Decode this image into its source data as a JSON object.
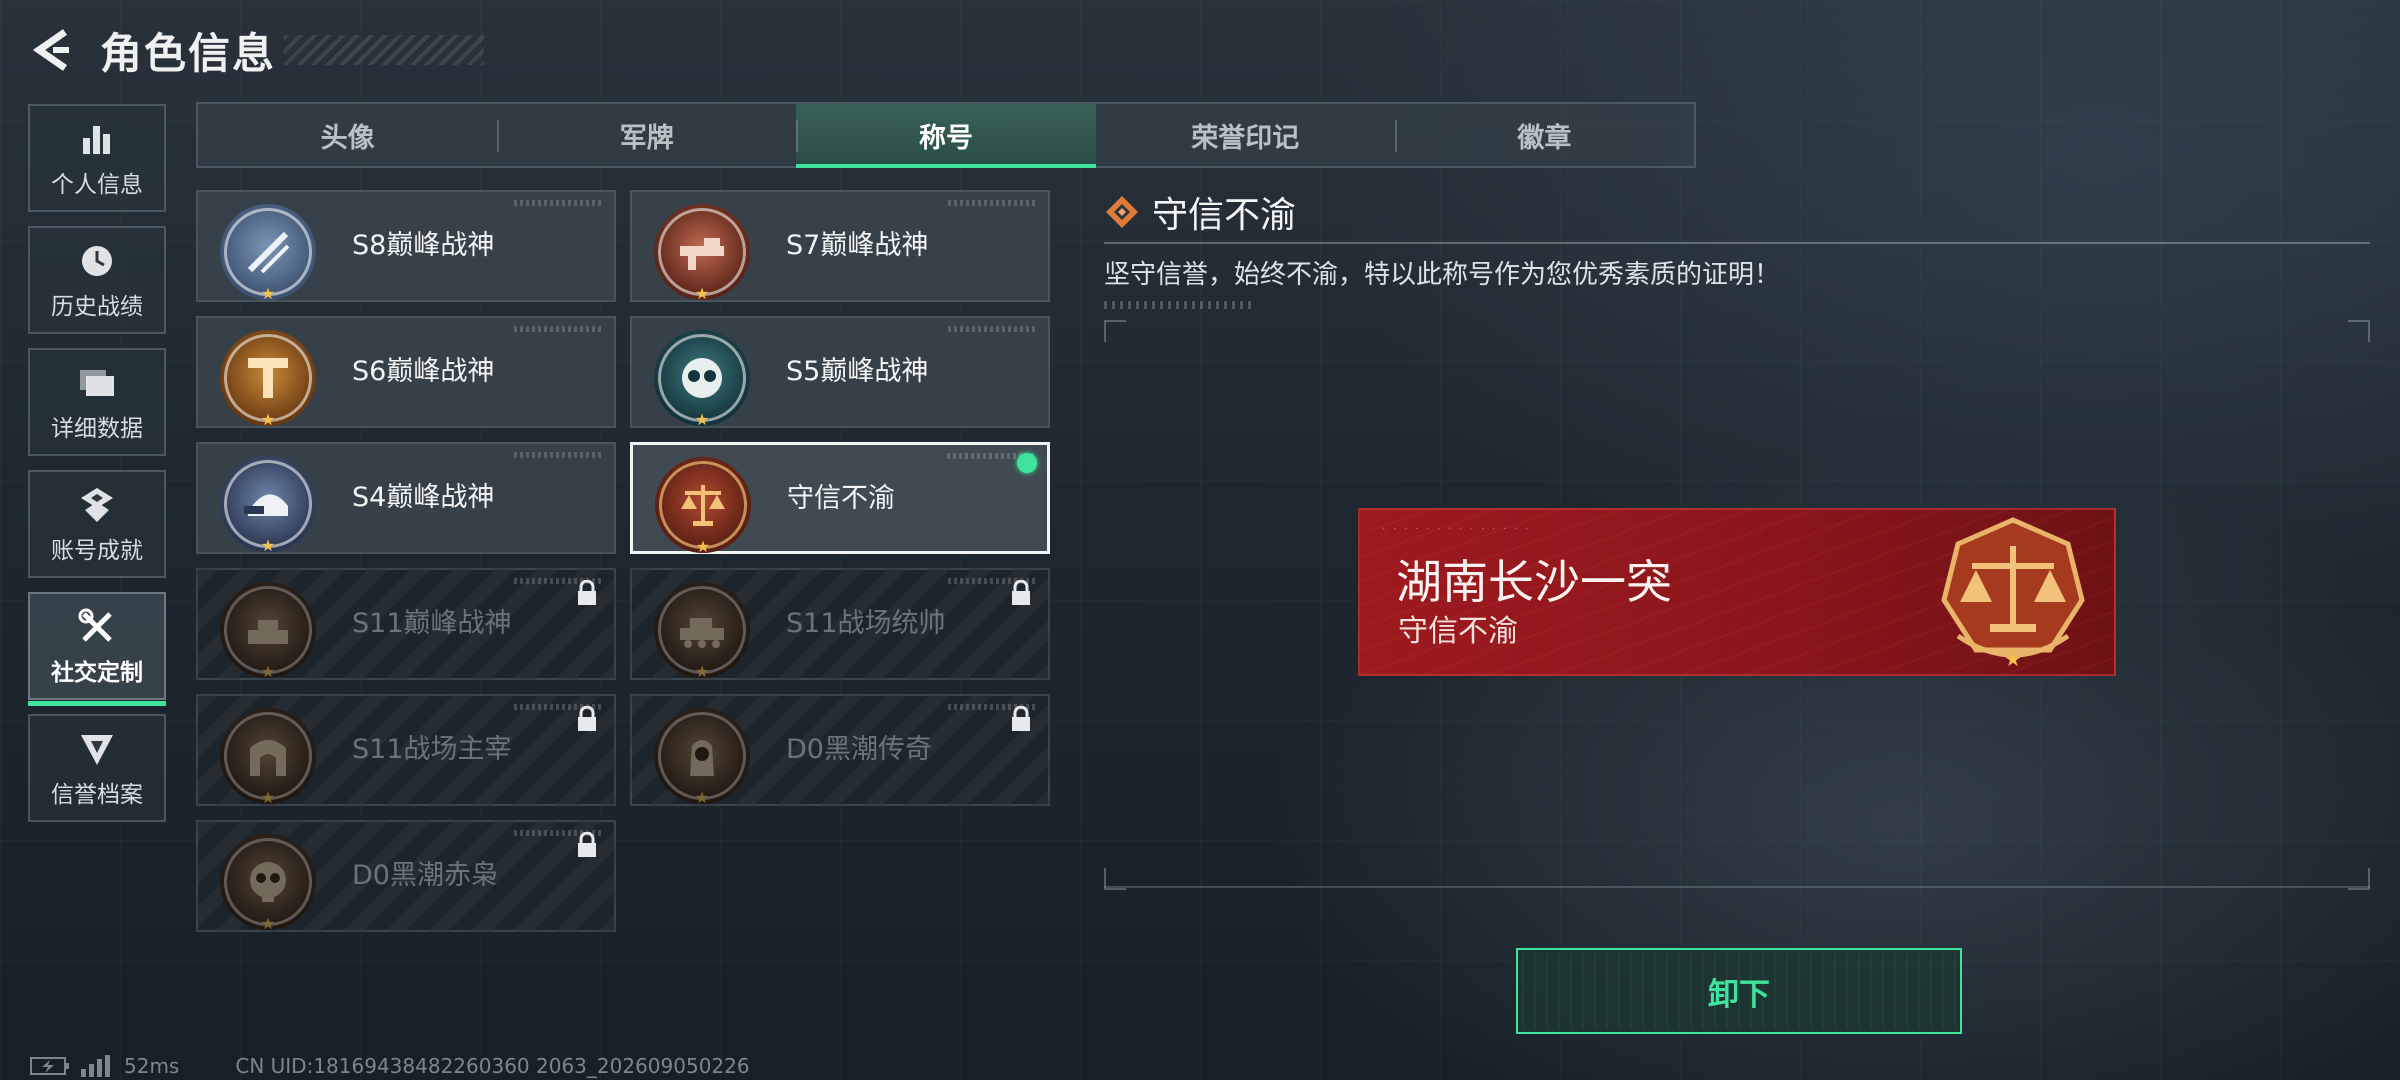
{
  "header": {
    "title": "角色信息"
  },
  "sidebar": {
    "items": [
      {
        "label": "个人信息"
      },
      {
        "label": "历史战绩"
      },
      {
        "label": "详细数据"
      },
      {
        "label": "账号成就"
      },
      {
        "label": "社交定制"
      },
      {
        "label": "信誉档案"
      }
    ]
  },
  "tabs": [
    {
      "label": "头像"
    },
    {
      "label": "军牌"
    },
    {
      "label": "称号"
    },
    {
      "label": "荣誉印记"
    },
    {
      "label": "徽章"
    }
  ],
  "titles": [
    {
      "name": "S8巅峰战神",
      "locked": false,
      "color": "#6a84a8"
    },
    {
      "name": "S7巅峰战神",
      "locked": false,
      "color": "#b05a43"
    },
    {
      "name": "S6巅峰战神",
      "locked": false,
      "color": "#b7772a"
    },
    {
      "name": "S5巅峰战神",
      "locked": false,
      "color": "#2f5f66"
    },
    {
      "name": "S4巅峰战神",
      "locked": false,
      "color": "#5a6f93"
    },
    {
      "name": "守信不渝",
      "locked": false,
      "selected": true,
      "color": "#a0402a"
    },
    {
      "name": "S11巅峰战神",
      "locked": true,
      "color": "#8a6a50"
    },
    {
      "name": "S11战场统帅",
      "locked": true,
      "color": "#8a6a50"
    },
    {
      "name": "S11战场主宰",
      "locked": true,
      "color": "#8a6a50"
    },
    {
      "name": "D0黑潮传奇",
      "locked": true,
      "color": "#8a6a50"
    },
    {
      "name": "D0黑潮赤枭",
      "locked": true,
      "color": "#8a6a50"
    }
  ],
  "detail": {
    "title": "守信不渝",
    "description": "坚守信誉，始终不渝，特以此称号作为您优秀素质的证明！"
  },
  "banner": {
    "player": "湖南长沙一突",
    "subtitle": "守信不渝"
  },
  "action": {
    "label": "卸下"
  },
  "status": {
    "ping": "52ms",
    "uid": "CN UID:18169438482260360 2063_202609050226"
  },
  "colors": {
    "accent": "#3fe39d",
    "banner": "#9e1a1f"
  }
}
